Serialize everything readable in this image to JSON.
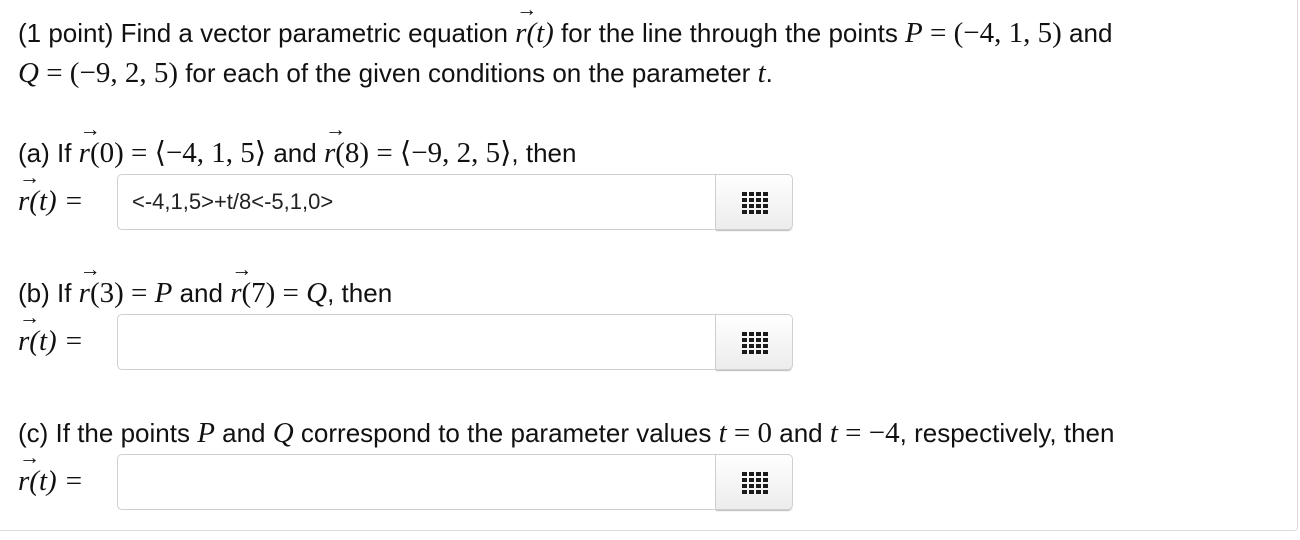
{
  "intro": {
    "line1_pre": "(1 point) Find a vector parametric equation ",
    "r": "r",
    "of_t": "(t)",
    "line1_mid": " for the line through the points ",
    "P": "P",
    "P_eq": " = (−4, 1, 5)",
    "and_word": " and",
    "Q": "Q",
    "Q_eq": " = (−9, 2, 5)",
    "line2_mid": " for each of the given conditions on the parameter ",
    "t": "t",
    "period": "."
  },
  "part_a": {
    "prefix": "(a) If ",
    "r": "r",
    "arg0": "(0) = ⟨−4, 1, 5⟩",
    "and_word": " and ",
    "arg8": "(8) = ⟨−9, 2, 5⟩",
    "then": ", then",
    "lhs_r": "r",
    "lhs_t": "(t) =",
    "answer_value": "<-4,1,5>+t/8<-5,1,0>"
  },
  "part_b": {
    "prefix": "(b) If ",
    "r": "r",
    "arg3": "(3) = ",
    "P": "P",
    "and_word": " and ",
    "arg7": "(7) = ",
    "Q": "Q",
    "then": ", then",
    "lhs_r": "r",
    "lhs_t": "(t) =",
    "answer_value": ""
  },
  "part_c": {
    "prefix": "(c) If the points ",
    "P": "P",
    "and_word": " and ",
    "Q": "Q",
    "mid": " correspond to the parameter values ",
    "t1": "t",
    "eq0": " = 0",
    "and_word2": " and ",
    "t2": "t",
    "eqm4": " = −4",
    "tail": ", respectively, then",
    "lhs_r": "r",
    "lhs_t": "(t) =",
    "answer_value": ""
  },
  "icons": {
    "palette": "grid-icon"
  },
  "colors": {
    "input_border": "#cfcfcf",
    "button_bg": "#ececec",
    "icon": "#1a1a1a"
  }
}
